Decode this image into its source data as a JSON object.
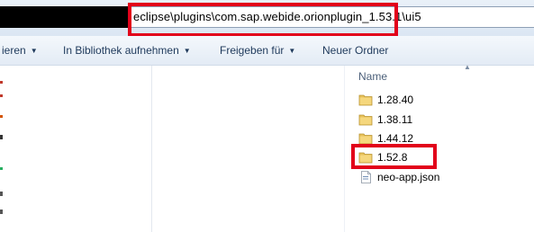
{
  "address_bar": {
    "path": "eclipse\\plugins\\com.sap.webide.orionplugin_1.53.1\\ui5"
  },
  "toolbar": {
    "organize_label": "ieren",
    "library_label": "In Bibliothek aufnehmen",
    "share_label": "Freigeben für",
    "new_folder_label": "Neuer Ordner"
  },
  "file_list": {
    "column_name": "Name",
    "items": [
      {
        "name": "1.28.40",
        "icon": "folder-icon"
      },
      {
        "name": "1.38.11",
        "icon": "folder-icon"
      },
      {
        "name": "1.44.12",
        "icon": "folder-icon"
      },
      {
        "name": "1.52.8",
        "icon": "folder-icon"
      },
      {
        "name": "neo-app.json",
        "icon": "json-file-icon"
      }
    ]
  },
  "colors": {
    "highlight_box": "#e2001a",
    "toolbar_text": "#1e395b",
    "folder_yellow": "#e8c25a"
  }
}
